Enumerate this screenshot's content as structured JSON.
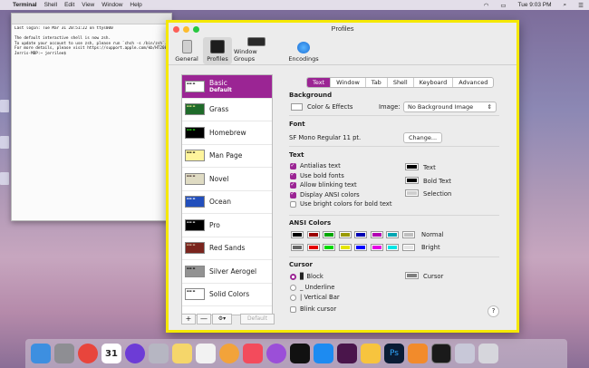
{
  "menubar": {
    "apple": "",
    "items": [
      "Terminal",
      "Shell",
      "Edit",
      "View",
      "Window",
      "Help"
    ],
    "clock": "Tue 9:03 PM"
  },
  "terminal": {
    "lines": "Last login: Tue Mar 31 20:51:22 on ttys000\n\nThe default interactive shell is now zsh.\nTo update your account to use zsh, please run `chsh -s /bin/zsh`.\nFor more details, please visit https://support.apple.com/kb/HT208050.\nJerris-MBP:~ jerrilee$ "
  },
  "window": {
    "title": "Profiles",
    "toolbar": [
      {
        "label": "General",
        "icon": "general-icon"
      },
      {
        "label": "Profiles",
        "icon": "profiles-icon"
      },
      {
        "label": "Window Groups",
        "icon": "window-groups-icon"
      },
      {
        "label": "Encodings",
        "icon": "encodings-icon"
      }
    ]
  },
  "profiles": [
    {
      "name": "Basic",
      "sub": "Default",
      "bg": "#ffffff",
      "fg": "#000000"
    },
    {
      "name": "Grass",
      "sub": "",
      "bg": "#1f6b2a",
      "fg": "#f6ef8f"
    },
    {
      "name": "Homebrew",
      "sub": "",
      "bg": "#000000",
      "fg": "#28fe14"
    },
    {
      "name": "Man Page",
      "sub": "",
      "bg": "#fef49c",
      "fg": "#000000"
    },
    {
      "name": "Novel",
      "sub": "",
      "bg": "#dfdbc3",
      "fg": "#3b2322"
    },
    {
      "name": "Ocean",
      "sub": "",
      "bg": "#224fbc",
      "fg": "#ffffff"
    },
    {
      "name": "Pro",
      "sub": "",
      "bg": "#000000",
      "fg": "#f2f2f2"
    },
    {
      "name": "Red Sands",
      "sub": "",
      "bg": "#7a251e",
      "fg": "#d7c9a7"
    },
    {
      "name": "Silver Aerogel",
      "sub": "",
      "bg": "#929292",
      "fg": "#000000"
    },
    {
      "name": "Solid Colors",
      "sub": "",
      "bg": "#ffffff",
      "fg": "#000000"
    }
  ],
  "profile_buttons": {
    "add": "+",
    "remove": "—",
    "gear": "⚙▾",
    "default": "Default"
  },
  "tabs": [
    "Text",
    "Window",
    "Tab",
    "Shell",
    "Keyboard",
    "Advanced"
  ],
  "active_tab": "Text",
  "background": {
    "heading": "Background",
    "color_label": "Color & Effects",
    "image_label": "Image:",
    "image_value": "No Background Image"
  },
  "font": {
    "heading": "Font",
    "value": "SF Mono Regular 11 pt.",
    "change": "Change..."
  },
  "text": {
    "heading": "Text",
    "options": [
      {
        "label": "Antialias text",
        "checked": true
      },
      {
        "label": "Use bold fonts",
        "checked": true
      },
      {
        "label": "Allow blinking text",
        "checked": true
      },
      {
        "label": "Display ANSI colors",
        "checked": true
      },
      {
        "label": "Use bright colors for bold text",
        "checked": false
      }
    ],
    "colors": [
      {
        "label": "Text",
        "color": "#000000"
      },
      {
        "label": "Bold Text",
        "color": "#000000"
      },
      {
        "label": "Selection",
        "color": "#cfcfcf"
      }
    ]
  },
  "ansi": {
    "heading": "ANSI Colors",
    "normal_label": "Normal",
    "bright_label": "Bright",
    "normal": [
      "#000000",
      "#990000",
      "#00a600",
      "#999900",
      "#0000b2",
      "#b200b2",
      "#00a6b2",
      "#bfbfbf"
    ],
    "bright": [
      "#666666",
      "#e50000",
      "#00d900",
      "#e5e500",
      "#0000ff",
      "#e500e5",
      "#00e5e5",
      "#e5e5e5"
    ]
  },
  "cursor": {
    "heading": "Cursor",
    "options": [
      {
        "label": "▊ Block",
        "selected": true
      },
      {
        "label": "_ Underline",
        "selected": false
      },
      {
        "label": "| Vertical Bar",
        "selected": false
      }
    ],
    "blink_label": "Blink cursor",
    "color_label": "Cursor",
    "color": "#7f7f7f"
  },
  "help": "?",
  "dock": [
    {
      "name": "finder",
      "color": "#3d8fe0"
    },
    {
      "name": "system-preferences",
      "color": "#8e8e93"
    },
    {
      "name": "chrome",
      "color": "#e8453c"
    },
    {
      "name": "calendar",
      "color": "#ffffff"
    },
    {
      "name": "siri",
      "color": "#6d3cd6"
    },
    {
      "name": "launchpad",
      "color": "#b6b6c2"
    },
    {
      "name": "notes",
      "color": "#f5d66a"
    },
    {
      "name": "reminders",
      "color": "#f2f2f2"
    },
    {
      "name": "photos",
      "color": "#f2a33a"
    },
    {
      "name": "music",
      "color": "#f34b5c"
    },
    {
      "name": "podcasts",
      "color": "#9b4fd8"
    },
    {
      "name": "tv",
      "color": "#111111"
    },
    {
      "name": "app-store",
      "color": "#1d8bf1"
    },
    {
      "name": "slack",
      "color": "#4a154b"
    },
    {
      "name": "sketch",
      "color": "#f7c43e"
    },
    {
      "name": "photoshop",
      "color": "#0a1c35"
    },
    {
      "name": "books",
      "color": "#f28b2b"
    },
    {
      "name": "terminal",
      "color": "#1a1a1a"
    },
    {
      "name": "downloads",
      "color": "#c8c8d8"
    },
    {
      "name": "trash",
      "color": "#d6d6dc"
    }
  ],
  "calendar_day": "31"
}
